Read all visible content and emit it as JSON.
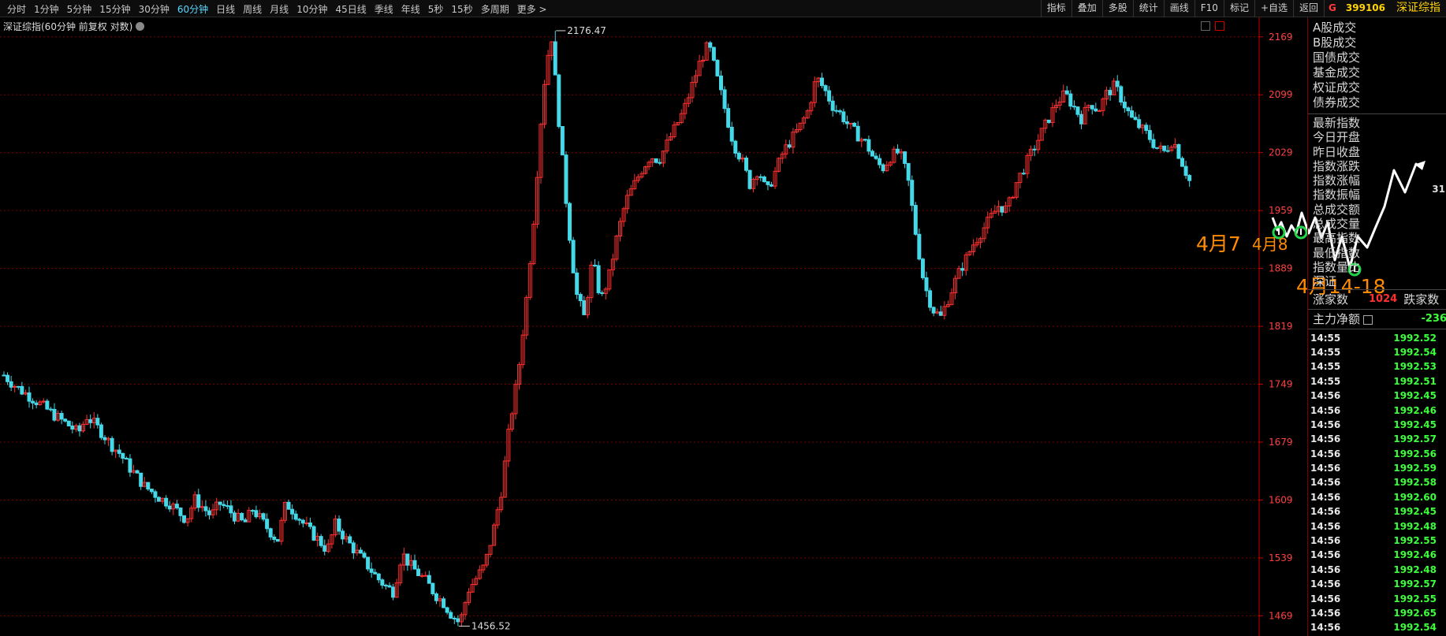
{
  "toolbar": {
    "periods": [
      "分时",
      "1分钟",
      "5分钟",
      "15分钟",
      "30分钟",
      "60分钟",
      "日线",
      "周线",
      "月线",
      "10分钟",
      "45日线",
      "季线",
      "年线",
      "5秒",
      "15秒",
      "多周期",
      "更多 >"
    ],
    "active_period": "60分钟",
    "tools": [
      "指标",
      "叠加",
      "多股",
      "统计",
      "画线",
      "F10",
      "标记",
      "+自选",
      "返回"
    ],
    "badge": "G",
    "code": "399106",
    "index_name": "深证综指"
  },
  "chart": {
    "subtitle": "深证综指(60分钟 前复权 对数)",
    "high_label": "2176.47",
    "low_label": "1456.52",
    "y_ticks": [
      "2169",
      "2099",
      "2029",
      "1959",
      "1889",
      "1819",
      "1749",
      "1679",
      "1609",
      "1539",
      "1469"
    ],
    "colors": {
      "up": "#ff3030",
      "down": "#44d8e8",
      "grid": "#7a0000",
      "axis_text": "#ff4040"
    }
  },
  "chart_data": {
    "type": "candlestick",
    "title": "深证综指(60分钟 前复权 对数)",
    "y_ticks": [
      2169,
      2099,
      2029,
      1959,
      1889,
      1819,
      1749,
      1679,
      1609,
      1539,
      1469
    ],
    "ylim": [
      1456,
      2185
    ],
    "annotations": [
      {
        "label": "2176.47",
        "value": 2176.47,
        "type": "period-high"
      },
      {
        "label": "1456.52",
        "value": 1456.52,
        "type": "period-low"
      }
    ],
    "close_path": [
      1760,
      1750,
      1742,
      1735,
      1728,
      1720,
      1712,
      1705,
      1698,
      1690,
      1710,
      1700,
      1688,
      1675,
      1665,
      1650,
      1638,
      1625,
      1618,
      1610,
      1605,
      1595,
      1585,
      1610,
      1600,
      1590,
      1605,
      1598,
      1588,
      1580,
      1598,
      1585,
      1572,
      1560,
      1605,
      1595,
      1582,
      1570,
      1560,
      1548,
      1580,
      1565,
      1552,
      1540,
      1528,
      1515,
      1505,
      1498,
      1545,
      1530,
      1520,
      1510,
      1495,
      1485,
      1470,
      1460,
      1500,
      1515,
      1530,
      1570,
      1620,
      1700,
      1760,
      1850,
      1960,
      2100,
      2176,
      2060,
      1950,
      1860,
      1830,
      1900,
      1850,
      1880,
      1930,
      1970,
      1990,
      2010,
      2025,
      2020,
      2040,
      2060,
      2080,
      2110,
      2140,
      2160,
      2120,
      2080,
      2040,
      2020,
      1990,
      2010,
      1980,
      2005,
      2030,
      2045,
      2060,
      2080,
      2120,
      2105,
      2085,
      2075,
      2060,
      2050,
      2040,
      2020,
      2010,
      2025,
      2030,
      2000,
      1930,
      1870,
      1840,
      1830,
      1855,
      1880,
      1900,
      1920,
      1935,
      1950,
      1965,
      1960,
      1990,
      2010,
      2030,
      2050,
      2070,
      2090,
      2100,
      2085,
      2070,
      2090,
      2080,
      2100,
      2110,
      2090,
      2070,
      2060,
      2050,
      2035,
      2030,
      2045,
      2020,
      1995
    ]
  },
  "annotations": {
    "label_a": "4月7",
    "label_b": "4月8",
    "label_c": "4月14-18"
  },
  "side_panel": {
    "turnover_items": [
      "A股成交",
      "B股成交",
      "国债成交",
      "基金成交",
      "权证成交",
      "债券成交"
    ],
    "stat_items": [
      "最新指数",
      "今日开盘",
      "昨日收盘",
      "指数涨跌",
      "指数涨幅",
      "指数振幅",
      "总成交额",
      "总成交量",
      "最高指数",
      "最低指数",
      "指数量比",
      "深证"
    ],
    "stat_value": "31",
    "up_count_label": "涨家数",
    "up_count_value": "1024",
    "down_count_label": "跌家数",
    "net_flow_label": "主力净额",
    "net_flow_value": "-236",
    "ticks": [
      [
        "14:55",
        "1992.52"
      ],
      [
        "14:55",
        "1992.54"
      ],
      [
        "14:55",
        "1992.53"
      ],
      [
        "14:55",
        "1992.51"
      ],
      [
        "14:56",
        "1992.45"
      ],
      [
        "14:56",
        "1992.46"
      ],
      [
        "14:56",
        "1992.45"
      ],
      [
        "14:56",
        "1992.57"
      ],
      [
        "14:56",
        "1992.56"
      ],
      [
        "14:56",
        "1992.59"
      ],
      [
        "14:56",
        "1992.58"
      ],
      [
        "14:56",
        "1992.60"
      ],
      [
        "14:56",
        "1992.45"
      ],
      [
        "14:56",
        "1992.48"
      ],
      [
        "14:56",
        "1992.55"
      ],
      [
        "14:56",
        "1992.46"
      ],
      [
        "14:56",
        "1992.48"
      ],
      [
        "14:56",
        "1992.57"
      ],
      [
        "14:56",
        "1992.55"
      ],
      [
        "14:56",
        "1992.65"
      ],
      [
        "14:56",
        "1992.54"
      ]
    ]
  }
}
